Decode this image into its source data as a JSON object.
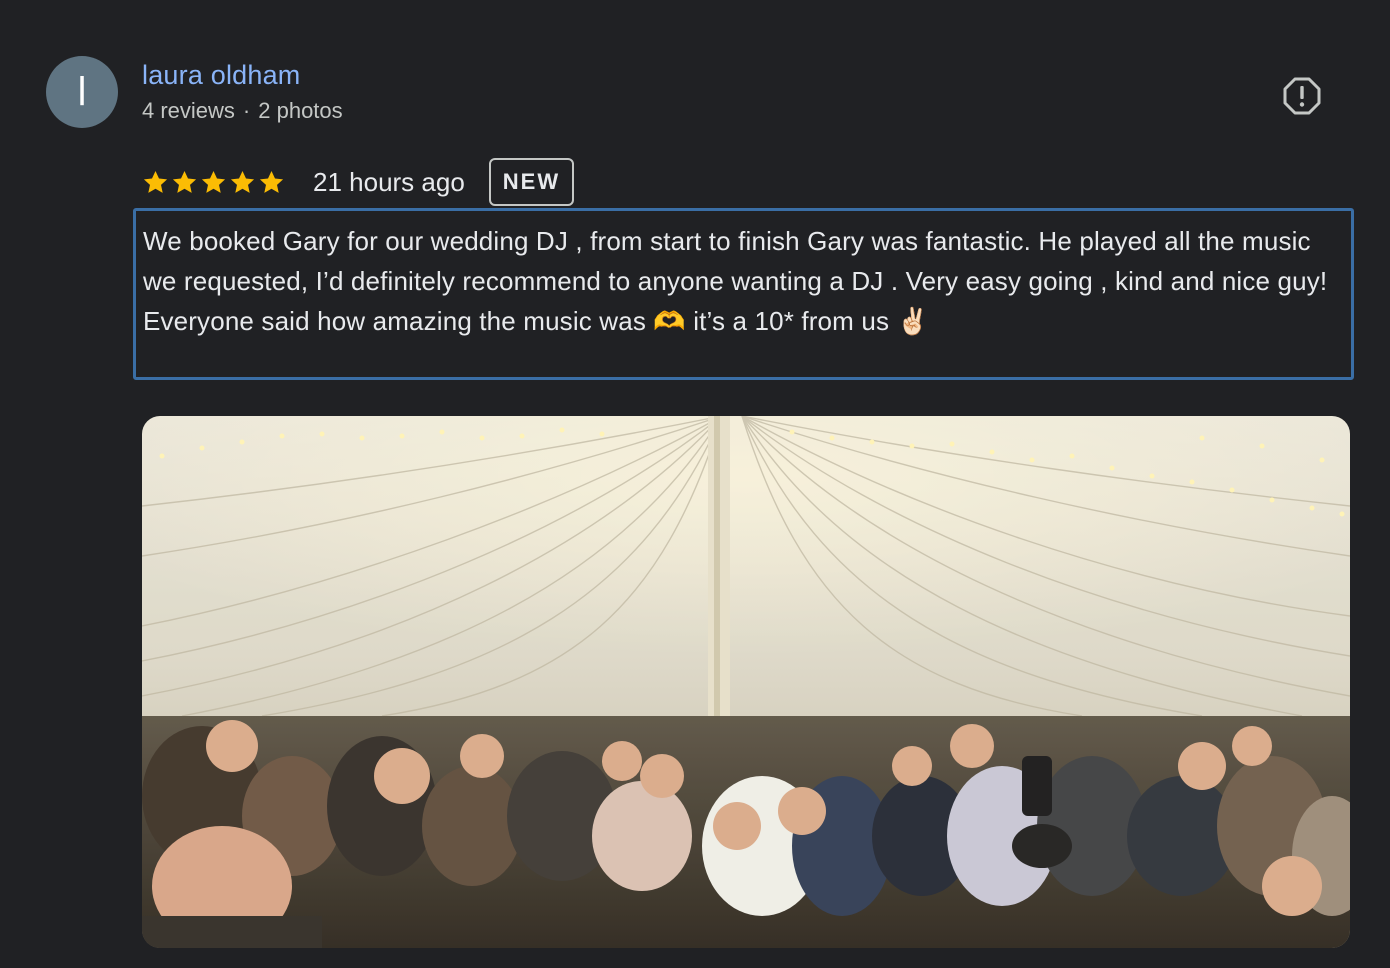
{
  "reviewer": {
    "avatar_initial": "l",
    "name": "laura oldham",
    "reviews": "4 reviews",
    "separator": "·",
    "photos": "2 photos"
  },
  "rating": {
    "stars": 5,
    "max_stars": 5,
    "star_color": "#fbbc04",
    "time_ago": "21 hours ago",
    "badge": "NEW"
  },
  "review": {
    "paragraph_1": "We booked Gary for our wedding DJ , from start to finish Gary was fantastic. He played all the music we requested, I’d definitely recommend to anyone wanting a DJ . Very easy going , kind and nice guy!",
    "paragraph_2": "Everyone said how amazing the music was 🫶 it’s a 10* from us ✌🏻"
  },
  "icons": {
    "report": "report-flag-icon",
    "star": "star-icon"
  },
  "colors": {
    "background": "#202124",
    "name_link": "#8ab4f8",
    "focus_border": "#3a6ea5"
  }
}
